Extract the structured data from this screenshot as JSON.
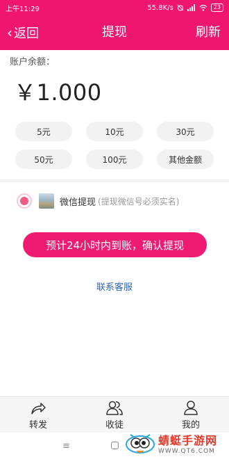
{
  "status_bar": {
    "time": "上午11:29",
    "net_speed": "55.8K/s",
    "battery": "23",
    "icons": [
      "alarm-off-icon",
      "signal-icon",
      "wifi-icon",
      "battery-icon"
    ]
  },
  "header": {
    "back_label": "返回",
    "title": "提现",
    "refresh_label": "刷新",
    "bg_color": "#f0156f"
  },
  "balance": {
    "label": "账户余额：",
    "value": "￥1.000"
  },
  "amounts": [
    "5元",
    "10元",
    "30元",
    "50元",
    "100元",
    "其他金额"
  ],
  "payment": {
    "name": "微信提现",
    "note": "(提现微信号必须实名)",
    "selected": true
  },
  "confirm_button": "预计24小时内到账，确认提现",
  "contact_link": "联系客服",
  "tabbar": {
    "items": [
      {
        "label": "转发",
        "icon": "share-icon"
      },
      {
        "label": "收徒",
        "icon": "users-icon"
      },
      {
        "label": "我的",
        "icon": "person-icon"
      }
    ]
  },
  "navbar": {
    "menu_glyph": "≡"
  },
  "watermark": {
    "name": "蜻蜓手游网",
    "url": "WWW.QT6.COM"
  }
}
